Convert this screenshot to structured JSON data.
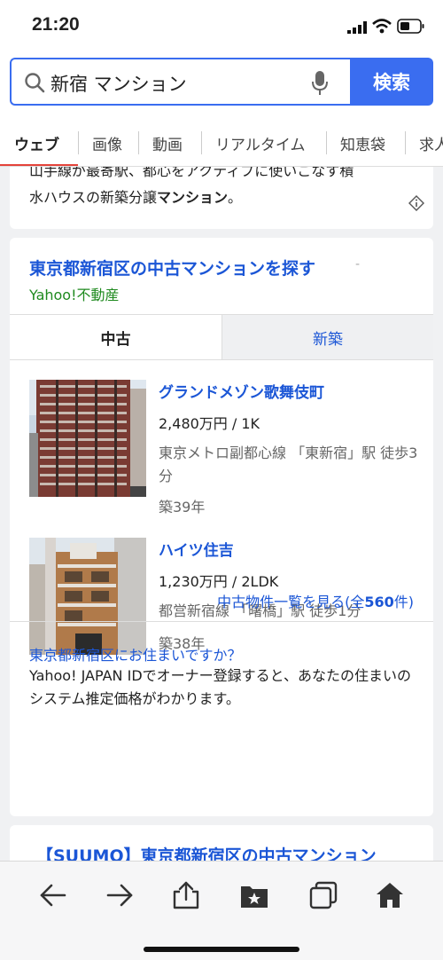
{
  "status_bar": {
    "time": "21:20"
  },
  "search": {
    "query": "新宿 マンション",
    "button_label": "検索"
  },
  "tabs": [
    {
      "label": "ウェブ",
      "active": true
    },
    {
      "label": "画像"
    },
    {
      "label": "動画"
    },
    {
      "label": "リアルタイム"
    },
    {
      "label": "知恵袋"
    },
    {
      "label": "求人"
    }
  ],
  "prev_result": {
    "line1": "山手線が最寄駅、都心をアクティブに使いこなす積",
    "line2_prefix": "水ハウスの新築分譲",
    "line2_bold": "マンション",
    "line2_suffix": "。"
  },
  "realestate_card": {
    "title": "東京都新宿区の中古マンションを探す",
    "title_suffix": "-",
    "source": "Yahoo!不動産",
    "segments": {
      "used": "中古",
      "new": "新築"
    },
    "listings": [
      {
        "name": "グランドメゾン歌舞伎町",
        "price": "2,480万円 / 1K",
        "access": "東京メトロ副都心線 「東新宿」駅 徒歩3分",
        "age": "築39年"
      },
      {
        "name": "ハイツ住吉",
        "price": "1,230万円 / 2LDK",
        "access": "都営新宿線 「曙橋」駅 徒歩1分",
        "age": "築38年"
      }
    ],
    "more_link_prefix": "中古物件一覧を見る(全",
    "more_link_count": "560",
    "more_link_suffix": "件)",
    "owner_question": "東京都新宿区にお住まいですか？",
    "owner_desc": "Yahoo! JAPAN IDでオーナー登録すると、あなたの住まいのシステム推定価格がわかります。"
  },
  "next_result": {
    "title": "【SUUMO】東京都新宿区の中古マンション"
  },
  "toolbar": {
    "icons": [
      "back-arrow-icon",
      "forward-arrow-icon",
      "share-icon",
      "bookmarks-icon",
      "tabs-icon",
      "home-icon"
    ]
  }
}
